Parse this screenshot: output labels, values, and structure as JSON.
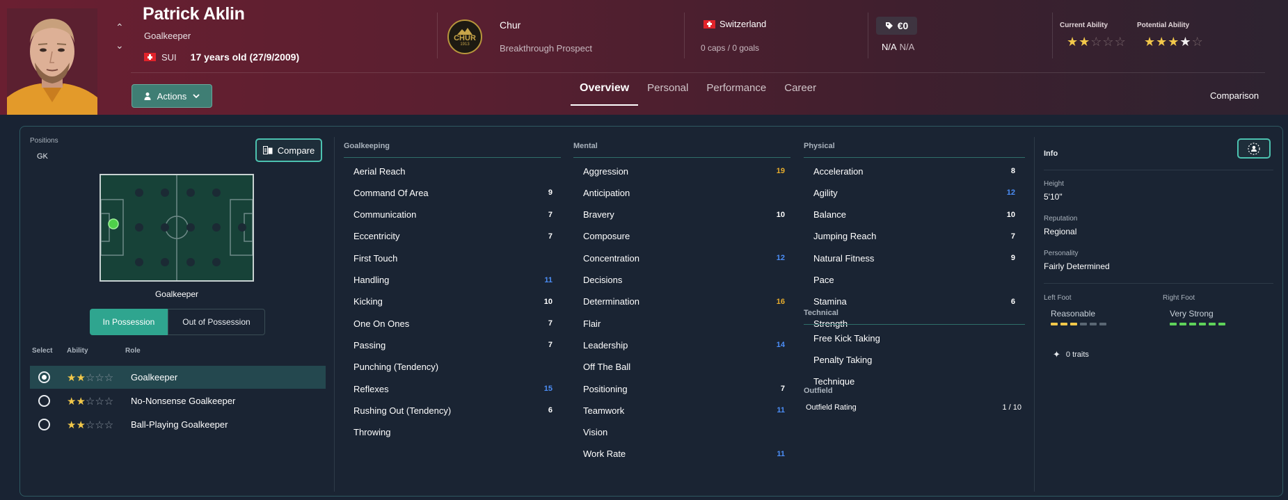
{
  "player": {
    "name": "Patrick Aklin",
    "position": "Goalkeeper",
    "nation_code": "SUI",
    "age_text": "17 years old (27/9/2009)"
  },
  "club": {
    "badge_text": "CHUR",
    "badge_year": "1913",
    "name": "Chur",
    "status": "Breakthrough Prospect"
  },
  "nation": {
    "name": "Switzerland",
    "caps": "0 caps / 0 goals"
  },
  "value": {
    "amount": "€0",
    "wage_a": "N/A",
    "wage_b": "N/A"
  },
  "ability": {
    "current_label": "Current Ability",
    "current_stars": 2,
    "potential_label": "Potential Ability",
    "potential_stars": 3.5
  },
  "actions_label": "Actions",
  "tabs": [
    "Overview",
    "Personal",
    "Performance",
    "Career"
  ],
  "active_tab": "Overview",
  "comparison_label": "Comparison",
  "positions": {
    "label": "Positions",
    "value": "GK",
    "compare_label": "Compare",
    "pitch_label": "Goalkeeper",
    "in_possession": "In Possession",
    "out_possession": "Out of Possession"
  },
  "roles": {
    "headers": [
      "Select",
      "Ability",
      "Role"
    ],
    "items": [
      {
        "name": "Goalkeeper",
        "stars": 2,
        "selected": true
      },
      {
        "name": "No-Nonsense Goalkeeper",
        "stars": 2,
        "selected": false
      },
      {
        "name": "Ball-Playing Goalkeeper",
        "stars": 2,
        "selected": false
      }
    ]
  },
  "goalkeeping": {
    "title": "Goalkeeping",
    "attrs": [
      {
        "name": "Aerial Reach",
        "value": "",
        "color": "w"
      },
      {
        "name": "Command Of Area",
        "value": "9",
        "color": "w"
      },
      {
        "name": "Communication",
        "value": "7",
        "color": "w"
      },
      {
        "name": "Eccentricity",
        "value": "7",
        "color": "w"
      },
      {
        "name": "First Touch",
        "value": "",
        "color": "w"
      },
      {
        "name": "Handling",
        "value": "11",
        "color": "b"
      },
      {
        "name": "Kicking",
        "value": "10",
        "color": "w"
      },
      {
        "name": "One On Ones",
        "value": "7",
        "color": "w"
      },
      {
        "name": "Passing",
        "value": "7",
        "color": "w"
      },
      {
        "name": "Punching (Tendency)",
        "value": "",
        "color": "w"
      },
      {
        "name": "Reflexes",
        "value": "15",
        "color": "b"
      },
      {
        "name": "Rushing Out (Tendency)",
        "value": "6",
        "color": "w"
      },
      {
        "name": "Throwing",
        "value": "",
        "color": "w"
      }
    ]
  },
  "mental": {
    "title": "Mental",
    "attrs": [
      {
        "name": "Aggression",
        "value": "19",
        "color": "o"
      },
      {
        "name": "Anticipation",
        "value": "",
        "color": "w"
      },
      {
        "name": "Bravery",
        "value": "10",
        "color": "w"
      },
      {
        "name": "Composure",
        "value": "",
        "color": "w"
      },
      {
        "name": "Concentration",
        "value": "12",
        "color": "b"
      },
      {
        "name": "Decisions",
        "value": "",
        "color": "w"
      },
      {
        "name": "Determination",
        "value": "16",
        "color": "o"
      },
      {
        "name": "Flair",
        "value": "",
        "color": "w"
      },
      {
        "name": "Leadership",
        "value": "14",
        "color": "b"
      },
      {
        "name": "Off The Ball",
        "value": "",
        "color": "w"
      },
      {
        "name": "Positioning",
        "value": "7",
        "color": "w"
      },
      {
        "name": "Teamwork",
        "value": "11",
        "color": "b"
      },
      {
        "name": "Vision",
        "value": "",
        "color": "w"
      },
      {
        "name": "Work Rate",
        "value": "11",
        "color": "b"
      }
    ]
  },
  "physical": {
    "title": "Physical",
    "attrs": [
      {
        "name": "Acceleration",
        "value": "8",
        "color": "w"
      },
      {
        "name": "Agility",
        "value": "12",
        "color": "b"
      },
      {
        "name": "Balance",
        "value": "10",
        "color": "w"
      },
      {
        "name": "Jumping Reach",
        "value": "7",
        "color": "w"
      },
      {
        "name": "Natural Fitness",
        "value": "9",
        "color": "w"
      },
      {
        "name": "Pace",
        "value": "",
        "color": "w"
      },
      {
        "name": "Stamina",
        "value": "6",
        "color": "w"
      },
      {
        "name": "Strength",
        "value": "",
        "color": "w"
      }
    ]
  },
  "technical": {
    "title": "Technical",
    "attrs": [
      {
        "name": "Free Kick Taking",
        "value": ""
      },
      {
        "name": "Penalty Taking",
        "value": ""
      },
      {
        "name": "Technique",
        "value": ""
      }
    ]
  },
  "outfield": {
    "title": "Outfield",
    "rating_label": "Outfield Rating",
    "rating_value": "1 / 10"
  },
  "info": {
    "title": "Info",
    "height_label": "Height",
    "height": "5'10\"",
    "reputation_label": "Reputation",
    "reputation": "Regional",
    "personality_label": "Personality",
    "personality": "Fairly Determined",
    "left_foot_label": "Left Foot",
    "left_foot": "Reasonable",
    "left_foot_level": 3,
    "right_foot_label": "Right Foot",
    "right_foot": "Very Strong",
    "right_foot_level": 6,
    "traits": "0 traits"
  },
  "colors": {
    "header_accent": "#6a1f31",
    "teal": "#2fa58f",
    "star": "#f2c84a",
    "attr_blue": "#4c8ef7",
    "attr_orange": "#e8ad2c",
    "foot_left": "#f2c84a",
    "foot_right": "#5fd35a"
  }
}
